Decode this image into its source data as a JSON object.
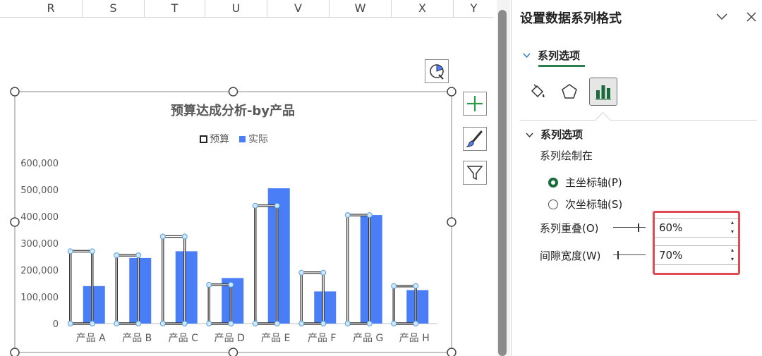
{
  "sheet": {
    "columns": [
      "R",
      "S",
      "T",
      "U",
      "V",
      "W",
      "X",
      "Y"
    ]
  },
  "chart_data": {
    "type": "bar",
    "title": "预算达成分析-by产品",
    "categories": [
      "产品 A",
      "产品 B",
      "产品 C",
      "产品 D",
      "产品 E",
      "产品 F",
      "产品 G",
      "产品 H"
    ],
    "series": [
      {
        "name": "预算",
        "values": [
          270000,
          255000,
          325000,
          145000,
          440000,
          190000,
          405000,
          140000
        ],
        "style": "outline",
        "color": "#444444"
      },
      {
        "name": "实际",
        "values": [
          140000,
          245000,
          270000,
          170000,
          505000,
          120000,
          405000,
          125000
        ],
        "style": "fill",
        "color": "#4a7ef7"
      }
    ],
    "y_ticks": [
      "0",
      "100,000",
      "200,000",
      "300,000",
      "400,000",
      "500,000",
      "600,000"
    ],
    "ylim": [
      0,
      600000
    ],
    "grid": false,
    "legend_position": "top"
  },
  "chart_tools": {
    "style_icon": "chart-style-icon",
    "add_element_icon": "plus-icon",
    "brush_icon": "brush-icon",
    "filter_icon": "filter-icon"
  },
  "pane": {
    "title": "设置数据系列格式",
    "tab_label": "系列选项",
    "icons": [
      "fill-line-icon",
      "effects-pentagon-icon",
      "series-options-bars-icon"
    ],
    "section_title": "系列选项",
    "plot_on_label": "系列绘制在",
    "primary_axis": "主坐标轴(P)",
    "secondary_axis": "次坐标轴(S)",
    "selected_axis": "primary",
    "overlap_label": "系列重叠(O)",
    "overlap_value": "60%",
    "overlap_level": 0.8,
    "gap_label": "间隙宽度(W)",
    "gap_value": "70%",
    "gap_level": 0.14,
    "accent": "#1a6b3c",
    "highlight_color": "#e04a52"
  }
}
